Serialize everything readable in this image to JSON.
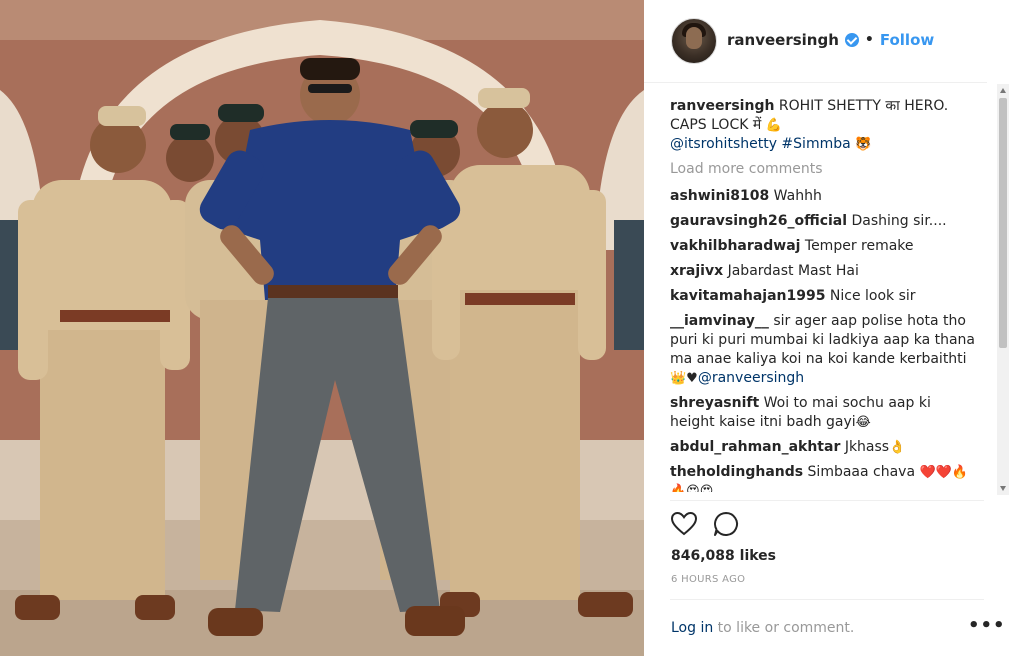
{
  "post": {
    "username": "ranveersingh",
    "follow_label": "Follow",
    "separator": "•",
    "caption": {
      "username": "ranveersingh",
      "text": "ROHIT SHETTY का HERO. CAPS LOCK में",
      "mentions": "@itsrohitshetty #Simmba"
    },
    "load_more": "Load more comments",
    "comments": [
      {
        "user": "ashwini8108",
        "text": "Wahhh"
      },
      {
        "user": "gauravsingh26_official",
        "text": "Dashing sir...."
      },
      {
        "user": "vakhilbharadwaj",
        "text": "Temper remake"
      },
      {
        "user": "xrajivx",
        "text": "Jabardast Mast Hai"
      },
      {
        "user": "kavitamahajan1995",
        "text": "Nice look sir"
      },
      {
        "user": "__iamvinay__",
        "text": "sir ager aap polise hota tho puri ki puri mumbai ki ladkiya aap ka thana ma anae kaliya koi na koi kande kerbaithti",
        "mention": "@ranveersingh"
      },
      {
        "user": "shreyasnift",
        "text": "Woi to mai sochu aap ki height kaise itni badh gayi"
      },
      {
        "user": "abdul_rahman_akhtar",
        "text": "Jkhass"
      },
      {
        "user": "theholdinghands",
        "text": "Simbaaa chava"
      }
    ],
    "likes": "846,088 likes",
    "time": "6 HOURS AGO",
    "login_link": "Log in",
    "login_rest": " to like or comment.",
    "more_label": "•••",
    "icons": [
      "heart-icon",
      "comment-icon",
      "more-options-icon",
      "verified-badge-icon"
    ],
    "colors": {
      "link": "#3897f0",
      "mention": "#003569",
      "muted": "#999999"
    }
  }
}
